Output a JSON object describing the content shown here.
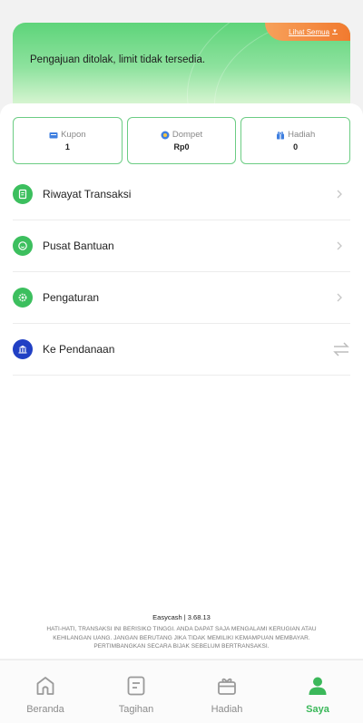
{
  "hero": {
    "link_label": "Lihat Semua",
    "message": "Pengajuan ditolak, limit tidak tersedia."
  },
  "stats": [
    {
      "label": "Kupon",
      "value": "1",
      "icon": "coupon-icon"
    },
    {
      "label": "Dompet",
      "value": "Rp0",
      "icon": "wallet-icon"
    },
    {
      "label": "Hadiah",
      "value": "0",
      "icon": "gift-icon"
    }
  ],
  "menu": [
    {
      "label": "Riwayat Transaksi",
      "icon": "receipt-icon"
    },
    {
      "label": "Pusat Bantuan",
      "icon": "help-center-icon"
    },
    {
      "label": "Pengaturan",
      "icon": "settings-icon"
    },
    {
      "label": "Ke Pendanaan",
      "icon": "bank-icon"
    }
  ],
  "footer": {
    "brand": "Easycash | 3.68.13",
    "warning_lines": [
      "HATI-HATI, TRANSAKSI INI BERISIKO TINGGI. ANDA DAPAT SAJA MENGALAMI KERUGIAN ATAU",
      "KEHILANGAN UANG. JANGAN BERUTANG JIKA TIDAK MEMILIKI KEMAMPUAN MEMBAYAR.",
      "PERTIMBANGKAN SECARA BIJAK SEBELUM BERTRANSAKSI."
    ]
  },
  "nav": [
    {
      "label": "Beranda",
      "icon": "home-icon"
    },
    {
      "label": "Tagihan",
      "icon": "bill-icon"
    },
    {
      "label": "Hadiah",
      "icon": "gift-icon"
    },
    {
      "label": "Saya",
      "icon": "profile-icon",
      "active": true
    }
  ],
  "colors": {
    "accent": "#3cbf5e",
    "brand_blue": "#2140c4",
    "orange": "#f17a2f"
  }
}
